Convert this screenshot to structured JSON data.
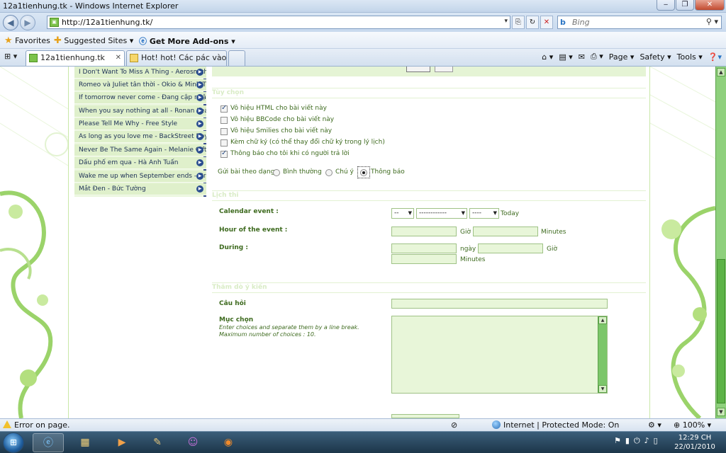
{
  "window": {
    "title": "12a1tienhung.tk - Windows Internet Explorer",
    "minimize": "‒",
    "maximize": "❐",
    "close": "✕"
  },
  "address": {
    "url": "http://12a1tienhung.tk/",
    "search_placeholder": "Bing"
  },
  "favorites_bar": {
    "favorites": "Favorites",
    "suggested": "Suggested Sites ▾",
    "addons": "Get More Add-ons ▾"
  },
  "tabs": [
    {
      "label": "12a1tienhung.tk"
    },
    {
      "label": "Hot! hot! Các pác vào cho ..."
    }
  ],
  "commands": {
    "page": "Page ▾",
    "safety": "Safety ▾",
    "tools": "Tools ▾"
  },
  "playlist": [
    "I Don't Want To Miss A Thing - Aerosmith",
    "Romeo và Juliet tân thời - Okio & Minh Th",
    "If tomorrow never come - Đang cập nhật",
    "When you say nothing at all - Ronan Kea",
    "Please Tell Me Why - Free Style",
    "As long as you love me - BackStreet Boy",
    "Never Be The Same Again - Melanie C ft",
    "Dấu phố em qua - Hà Anh Tuấn",
    "Wake me up when September ends - Gre",
    "Mắt Đen - Bức Tường"
  ],
  "sections": {
    "options": "Tùy chọn",
    "calendar": "Lịch thi",
    "poll": "Thăm dò ý kiến"
  },
  "options": [
    {
      "label": "Vô hiệu HTML cho bài viết này",
      "checked": true
    },
    {
      "label": "Vô hiệu BBCode cho bài viết này",
      "checked": false
    },
    {
      "label": "Vô hiệu Smilies cho bài viết này",
      "checked": false
    },
    {
      "label": "Kèm chữ ký (có thể thay đổi chữ ký trong lý lịch)",
      "checked": false
    },
    {
      "label": "Thông báo cho tôi khi có người trả lời",
      "checked": true
    }
  ],
  "post_type": {
    "label": "Gửi bài theo dạng:",
    "choices": [
      "Bình thường",
      "Chú ý",
      "Thông báo"
    ],
    "selected": "Thông báo"
  },
  "calendar": {
    "event_label": "Calendar event :",
    "day_value": "--",
    "month_value": "------------",
    "year_value": "----",
    "today": "Today",
    "hour_label": "Hour of the event :",
    "hour_unit": "Giờ",
    "minutes_unit": "Minutes",
    "during_label": "During :",
    "day_unit": "ngày",
    "during_hour_unit": "Giờ",
    "during_minutes_unit": "Minutes"
  },
  "poll": {
    "question_label": "Câu hỏi",
    "choices_label": "Mục chọn",
    "choices_help_1": "Enter choices and separate them by a line break.",
    "choices_help_2": "Maximum number of choices : 10."
  },
  "status": {
    "error": "Error on page.",
    "zone": "Internet | Protected Mode: On",
    "zoom": "100%"
  },
  "clock": {
    "time": "12:29 CH",
    "date": "22/01/2010"
  },
  "colors": {
    "accent_green": "#7cc66a",
    "label_green": "#3d6a1e",
    "field_bg": "#e8f6d9"
  }
}
